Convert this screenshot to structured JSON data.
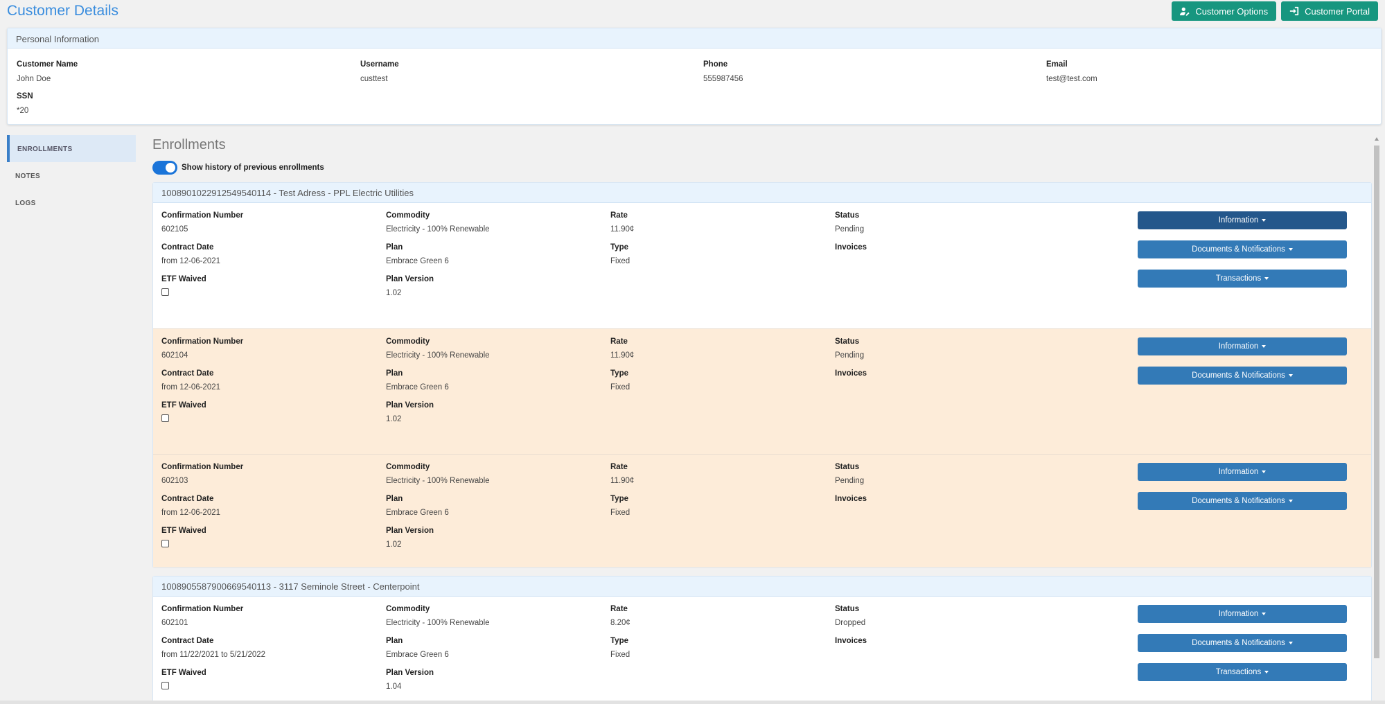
{
  "header": {
    "title": "Customer Details",
    "customer_options_label": "Customer Options",
    "customer_portal_label": "Customer Portal"
  },
  "personal_info": {
    "heading": "Personal Information",
    "fields": [
      {
        "label": "Customer Name",
        "value": "John Doe"
      },
      {
        "label": "Username",
        "value": "custtest"
      },
      {
        "label": "Phone",
        "value": "555987456"
      },
      {
        "label": "Email",
        "value": "test@test.com"
      },
      {
        "label": "SSN",
        "value": "*20"
      }
    ]
  },
  "sidebar": {
    "items": [
      {
        "label": "ENROLLMENTS",
        "active": true
      },
      {
        "label": "NOTES",
        "active": false
      },
      {
        "label": "LOGS",
        "active": false
      }
    ]
  },
  "enrollments": {
    "title": "Enrollments",
    "history_toggle_label": "Show history of previous enrollments",
    "labels": {
      "confirmation": "Confirmation Number",
      "commodity": "Commodity",
      "rate": "Rate",
      "status": "Status",
      "contract_date": "Contract Date",
      "plan": "Plan",
      "type": "Type",
      "invoices": "Invoices",
      "etf_waived": "ETF Waived",
      "plan_version": "Plan Version"
    },
    "buttons": {
      "information": "Information",
      "documents": "Documents & Notifications",
      "transactions": "Transactions"
    },
    "groups": [
      {
        "header": "1008901022912549540114 - Test Adress - PPL Electric Utilities",
        "items": [
          {
            "confirmation": "602105",
            "commodity": "Electricity - 100% Renewable",
            "rate": "11.90¢",
            "status": "Pending",
            "contract_date": "from 12-06-2021",
            "plan": "Embrace Green 6",
            "type": "Fixed",
            "plan_version": "1.02"
          },
          {
            "confirmation": "602104",
            "commodity": "Electricity - 100% Renewable",
            "rate": "11.90¢",
            "status": "Pending",
            "contract_date": "from 12-06-2021",
            "plan": "Embrace Green 6",
            "type": "Fixed",
            "plan_version": "1.02"
          },
          {
            "confirmation": "602103",
            "commodity": "Electricity - 100% Renewable",
            "rate": "11.90¢",
            "status": "Pending",
            "contract_date": "from 12-06-2021",
            "plan": "Embrace Green 6",
            "type": "Fixed",
            "plan_version": "1.02"
          }
        ]
      },
      {
        "header": "1008905587900669540113 - 3117 Seminole Street - Centerpoint",
        "items": [
          {
            "confirmation": "602101",
            "commodity": "Electricity - 100% Renewable",
            "rate": "8.20¢",
            "status": "Dropped",
            "contract_date": "from 11/22/2021 to 5/21/2022",
            "plan": "Embrace Green 6",
            "type": "Fixed",
            "plan_version": "1.04"
          }
        ]
      }
    ]
  }
}
